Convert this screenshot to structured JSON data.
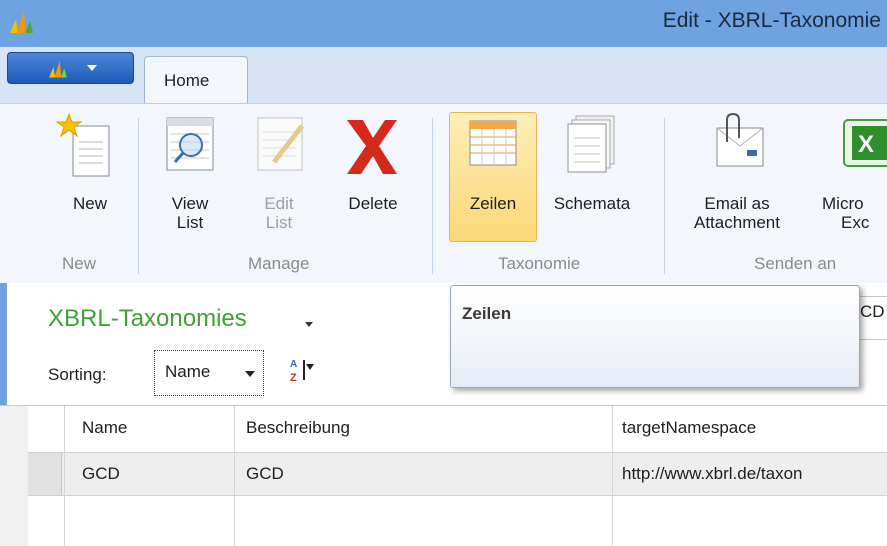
{
  "window": {
    "title": "Edit - XBRL-Taxonomie"
  },
  "ribbon": {
    "tabs": [
      {
        "label": "Home"
      }
    ],
    "buttons": {
      "new": "New",
      "view_list": [
        "View",
        "List"
      ],
      "edit_list": [
        "Edit",
        "List"
      ],
      "delete": "Delete",
      "zeilen": "Zeilen",
      "schemata": "Schemata",
      "email": [
        "Email as",
        "Attachment"
      ],
      "excel": [
        "Micro",
        "Exc"
      ]
    },
    "groups": {
      "new": "New",
      "manage": "Manage",
      "taxonomie": "Taxonomie",
      "senden_an": "Senden an"
    }
  },
  "tooltip": {
    "title": "Zeilen"
  },
  "list": {
    "title": "XBRL-Taxonomies",
    "right_fragment": "CD",
    "sorting_label": "Sorting:",
    "sort_field": "Name"
  },
  "grid": {
    "columns": [
      "Name",
      "Beschreibung",
      "targetNamespace"
    ],
    "rows": [
      {
        "name": "GCD",
        "beschreibung": "GCD",
        "targetNamespace": "http://www.xbrl.de/taxon"
      }
    ]
  },
  "colors": {
    "titlebar": "#6ea2e1",
    "list_title": "#3ea234",
    "highlight": "#fbd777"
  }
}
